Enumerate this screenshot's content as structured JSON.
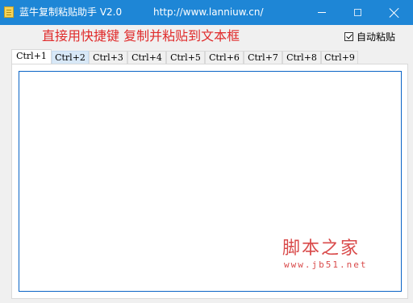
{
  "window": {
    "title": "蓝牛复制粘贴助手 V2.0",
    "url": "http://www.lanniuw.cn/",
    "accent_color": "#1e86d6"
  },
  "hint": {
    "text": "直接用快捷键  复制并粘贴到文本框",
    "color": "#e02b2b"
  },
  "auto_paste": {
    "label": "自动粘贴",
    "checked": true
  },
  "tabs": [
    {
      "label": "Ctrl+1",
      "active": true
    },
    {
      "label": "Ctrl+2",
      "hover": true
    },
    {
      "label": "Ctrl+3"
    },
    {
      "label": "Ctrl+4"
    },
    {
      "label": "Ctrl+5"
    },
    {
      "label": "Ctrl+6"
    },
    {
      "label": "Ctrl+7"
    },
    {
      "label": "Ctrl+8"
    },
    {
      "label": "Ctrl+9"
    }
  ],
  "textbox": {
    "value": ""
  },
  "watermark": {
    "title": "脚本之家",
    "url": "www.jb51.net",
    "color": "#d94a4a"
  }
}
